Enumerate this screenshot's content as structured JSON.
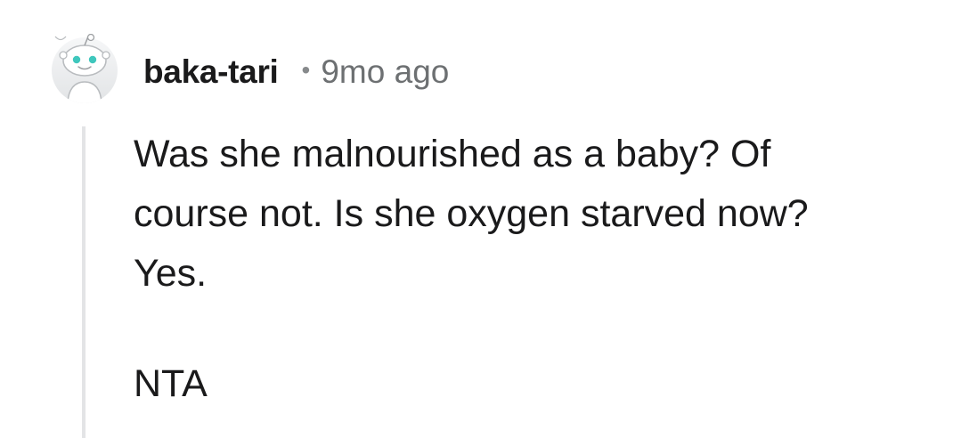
{
  "comment": {
    "author": {
      "username": "baka-tari",
      "avatar_icon": "snoo-avatar-icon"
    },
    "separator": "•",
    "timestamp": "9mo ago",
    "body": {
      "paragraph_1": {
        "line_1": "Was she malnourished as a baby? Of",
        "line_2": "course not. Is she oxygen starved now?",
        "line_3": "Yes."
      },
      "paragraph_2": "NTA"
    }
  },
  "colors": {
    "text": "#1a1a1b",
    "meta_text": "#6d7072",
    "thread_line": "#e3e4e6",
    "avatar_eyes": "#3fc7bd"
  }
}
